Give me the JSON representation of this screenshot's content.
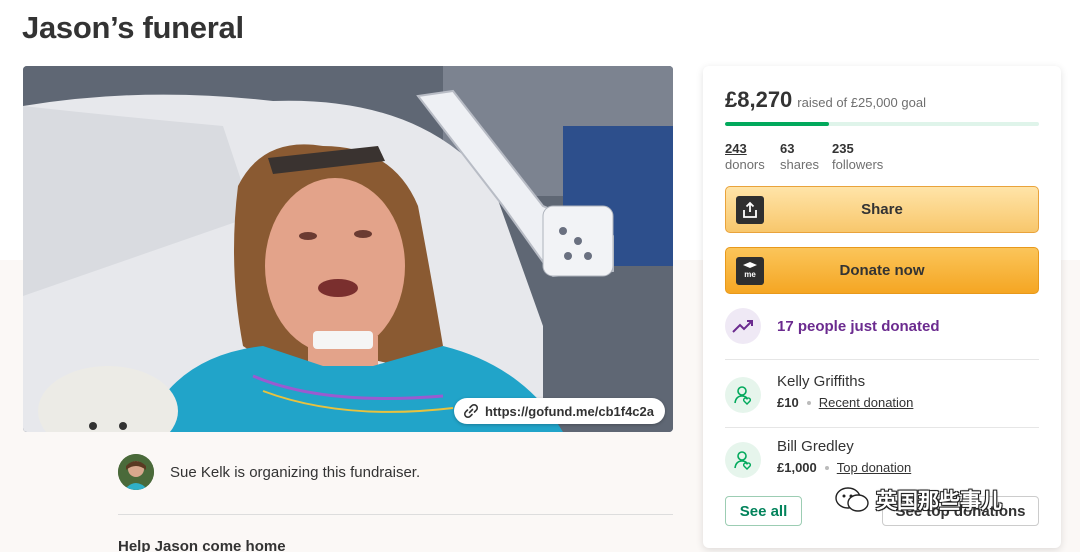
{
  "page": {
    "title": "Jason’s funeral"
  },
  "hero": {
    "link_url": "https://gofund.me/cb1f4c2a"
  },
  "organizer": {
    "text": "Sue Kelk is organizing this fundraiser."
  },
  "story": {
    "heading": "Help Jason come home"
  },
  "campaign": {
    "raised": "£8,270",
    "goal_text": "raised of £25,000 goal",
    "progress_fraction": 0.33,
    "stats": [
      {
        "value": "243",
        "label": "donors"
      },
      {
        "value": "63",
        "label": "shares"
      },
      {
        "value": "235",
        "label": "followers"
      }
    ],
    "share_label": "Share",
    "donate_label": "Donate now",
    "donate_icon_text": "me",
    "trend_text": "17 people just donated",
    "donations": [
      {
        "name": "Kelly Griffiths",
        "amount": "£10",
        "kind": "Recent donation"
      },
      {
        "name": "Bill Gredley",
        "amount": "£1,000",
        "kind": "Top donation"
      }
    ],
    "see_all_label": "See all",
    "see_top_label": "See top donations"
  },
  "watermark": {
    "text": "英国那些事儿"
  },
  "colors": {
    "accent_green": "#02a95c",
    "donate_orange": "#f5a623",
    "trend_purple": "#6b2b8f"
  }
}
